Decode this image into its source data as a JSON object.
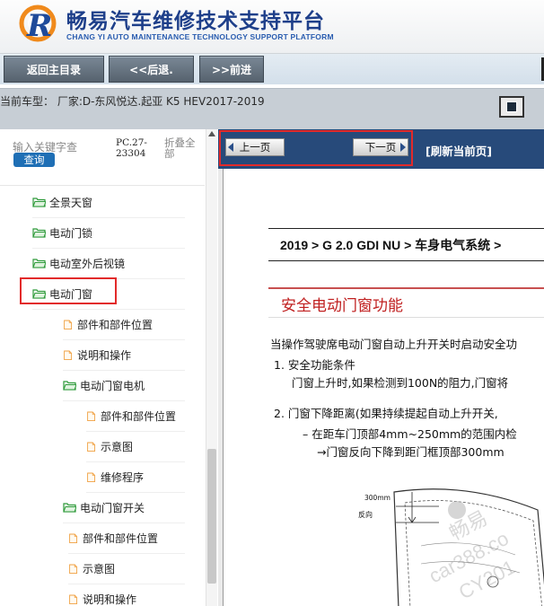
{
  "header": {
    "title_cn": "畅易汽车维修技术支持平台",
    "title_en": "CHANG YI AUTO MAINTENANCE TECHNOLOGY SUPPORT PLATFORM",
    "logo_icon": "brand-r-logo-icon"
  },
  "toolbar": {
    "home_label": "返回主目录",
    "back_label": "<<后退.",
    "forward_label": ">>前进"
  },
  "vehicle": {
    "text": "当前车型：  厂家:D-东风悦达.起亚 K5 HEV2017-2019"
  },
  "sidebar": {
    "search_placeholder": "输入关键字查",
    "search_button": "查询",
    "pc_code_line1": "PC.27-",
    "pc_code_line2": "23304",
    "collapse_line1": "折叠全",
    "collapse_line2": "部",
    "items": [
      {
        "label": "全景天窗",
        "icon": "folder-open-icon"
      },
      {
        "label": "电动门锁",
        "icon": "folder-open-icon"
      },
      {
        "label": "电动室外后视镜",
        "icon": "folder-open-icon"
      },
      {
        "label": "电动门窗",
        "icon": "folder-open-icon",
        "selected": true
      },
      {
        "label": "部件和部件位置",
        "icon": "document-icon"
      },
      {
        "label": "说明和操作",
        "icon": "document-icon"
      },
      {
        "label": "电动门窗电机",
        "icon": "folder-open-icon"
      },
      {
        "label": "部件和部件位置",
        "icon": "document-icon"
      },
      {
        "label": "示意图",
        "icon": "document-icon"
      },
      {
        "label": "维修程序",
        "icon": "document-icon"
      },
      {
        "label": "电动门窗开关",
        "icon": "folder-open-icon"
      },
      {
        "label": "部件和部件位置",
        "icon": "document-icon"
      },
      {
        "label": "示意图",
        "icon": "document-icon"
      },
      {
        "label": "说明和操作",
        "icon": "document-icon"
      }
    ]
  },
  "nav": {
    "prev_label": "上一页",
    "next_label": "下一页",
    "refresh_label": "[刷新当前页]"
  },
  "doc": {
    "breadcrumb": "2019 > G 2.0 GDI NU > 车身电气系统 >",
    "section_title": "安全电动门窗功能",
    "intro": "当操作驾驶席电动门窗自动上升开关时启动安全功",
    "item1_title": "1.  安全功能条件",
    "item1_body": "门窗上升时,如果检测到100N的阻力,门窗将",
    "item2_title": "2.  门窗下降距离(如果持续提起自动上升开关,",
    "item2_sub1": "–  在距车门顶部4mm~250mm的范围内检",
    "item2_sub2": "→门窗反向下降到距门框顶部300mm",
    "fig_label_distance": "300mm",
    "fig_label_reverse": "反向",
    "watermark1": "畅易",
    "watermark2": "car388.co",
    "watermark3": "CY201"
  },
  "colors": {
    "brand_blue": "#1e3f8a",
    "nav_blue": "#274a7a",
    "search_blue": "#1f6fb5",
    "highlight_red": "#e22a2a",
    "title_red": "#c02020",
    "folder_green": "#2e9a3a",
    "doc_orange": "#f0a040"
  }
}
